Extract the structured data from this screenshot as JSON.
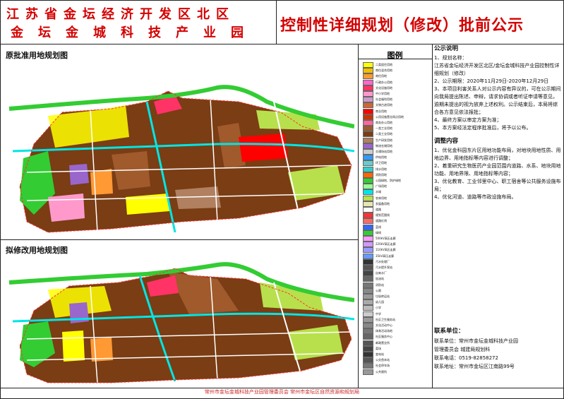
{
  "header": {
    "title_line1": "江苏省金坛经济开发区北区",
    "title_line2": "金坛金城科技产业园",
    "title_main": "控制性详细规划（修改）批前公示"
  },
  "panels": {
    "original_label": "原批准用地规划图",
    "revised_label": "拟修改用地规划图"
  },
  "legend": {
    "title": "图例",
    "items": [
      {
        "label": "二类居住用地",
        "color": "#ffff00"
      },
      {
        "label": "商住混合用地",
        "color": "#f0c000"
      },
      {
        "label": "商住用地",
        "color": "#ff9933"
      },
      {
        "label": "行政办公用地",
        "color": "#ff66cc"
      },
      {
        "label": "文化设施用地",
        "color": "#ff3366"
      },
      {
        "label": "中小学用地",
        "color": "#ff99cc"
      },
      {
        "label": "社会福利用地",
        "color": "#cc99cc"
      },
      {
        "label": "文物古迹用地",
        "color": "#cc6633"
      },
      {
        "label": "商业用地",
        "color": "#ff0000"
      },
      {
        "label": "公用设施营业网点用地",
        "color": "#cc3300"
      },
      {
        "label": "商务办公用地",
        "color": "#ff6699"
      },
      {
        "label": "一类工业用地",
        "color": "#a05a2c"
      },
      {
        "label": "二类工业用地",
        "color": "#7a3d14"
      },
      {
        "label": "生产研发用地",
        "color": "#b08060"
      },
      {
        "label": "物流仓储用地",
        "color": "#9966cc"
      },
      {
        "label": "交通场站用地",
        "color": "#cccccc"
      },
      {
        "label": "供电用地",
        "color": "#3399ff"
      },
      {
        "label": "环卫用地",
        "color": "#66cccc"
      },
      {
        "label": "排水用地",
        "color": "#33cccc"
      },
      {
        "label": "消防用地",
        "color": "#ff6600"
      },
      {
        "label": "公园绿地、防护绿地",
        "color": "#33cc33"
      },
      {
        "label": "广场用地",
        "color": "#99ff99"
      },
      {
        "label": "水域",
        "color": "#00e5e5"
      },
      {
        "label": "农林用地",
        "color": "#b8e04c"
      },
      {
        "label": "发展备用地",
        "color": "#e6e6b3"
      },
      {
        "label": "道路",
        "color": "#ffffff"
      },
      {
        "label": "规划范围线",
        "color": "#ff3333"
      },
      {
        "label": "道路红线",
        "color": "#ff6666"
      },
      {
        "label": "蓝线",
        "color": "#3366ff"
      },
      {
        "label": "绿线",
        "color": "#33cc33"
      },
      {
        "label": "500kV高压走廊",
        "color": "#ff99ff"
      },
      {
        "label": "220kV高压走廊",
        "color": "#cc99ff"
      },
      {
        "label": "110kV高压走廊",
        "color": "#9999ff"
      },
      {
        "label": "35kV高压走廊",
        "color": "#6699ff"
      },
      {
        "label": "污水处理厂",
        "color": "#333333"
      },
      {
        "label": "污水提升泵站",
        "color": "#555555"
      },
      {
        "label": "自来水厂",
        "color": "#444444"
      },
      {
        "label": "加油站",
        "color": "#666666"
      },
      {
        "label": "消防站",
        "color": "#777777"
      },
      {
        "label": "公厕",
        "color": "#888888"
      },
      {
        "label": "垃圾转运站",
        "color": "#999999"
      },
      {
        "label": "幼儿园",
        "color": "#aaaaaa"
      },
      {
        "label": "小学",
        "color": "#bbbbbb"
      },
      {
        "label": "中学",
        "color": "#cccccc"
      },
      {
        "label": "社区卫生服务站",
        "color": "#999999"
      },
      {
        "label": "文化活动中心",
        "color": "#888888"
      },
      {
        "label": "体育活动场地",
        "color": "#777777"
      },
      {
        "label": "社区服务中心",
        "color": "#666666"
      },
      {
        "label": "邮政营业所",
        "color": "#555555"
      },
      {
        "label": "菜场",
        "color": "#444444"
      },
      {
        "label": "变电站",
        "color": "#333333"
      },
      {
        "label": "公交首末站",
        "color": "#555555"
      },
      {
        "label": "社会停车场",
        "color": "#777777"
      },
      {
        "label": "公共厕所",
        "color": "#999999"
      }
    ]
  },
  "notice": {
    "title": "公示说明",
    "items": [
      "1、规划名称：",
      "江苏省金坛经济开发区北区/金坛金城科技产业园控制性详细规划（修改）",
      "2、公示期限：2020年11月29日-2020年12月29日",
      "3、本项目利害关系人对公示内容有异议的，可在公示期间向我局提出陈述、申辩，请求协调或者听证申请等意见，逾期未提出的视为放弃上述权利。公示结束后，本局将综合各方意见依法报批；",
      "4、最终方案以审定方案为准；",
      "5、本方案经法定程序批准后，将予以公布。"
    ],
    "adjust_title": "调整内容",
    "adjust_items": [
      "1、优化金科园东片区用地功能布局，对地块用地性质、用地边界、用地指标等内容进行调整；",
      "2、着重研究生物医药产业园范围内道路、水系、地块用地功能、用地界限、用地指标等内容；",
      "3、优化教育、工业邻里中心、职工宿舍等公共服务设施布局；",
      "4、优化河道、道路等市政设施布局。"
    ]
  },
  "contact": {
    "title": "联系单位：",
    "unit_label": "联系单位：",
    "unit_value": "常州市金坛金城科技产业园",
    "unit_value2": "管理委员会  城建局规划科",
    "phone_label": "联系电话：",
    "phone_value": "0519-82858272",
    "addr_label": "联系地址：",
    "addr_value": "常州市金坛区江南路99号"
  },
  "footer": {
    "text": "常州市金坛金城科技产业园管理委员会  常州市金坛区自然资源和规划局"
  }
}
